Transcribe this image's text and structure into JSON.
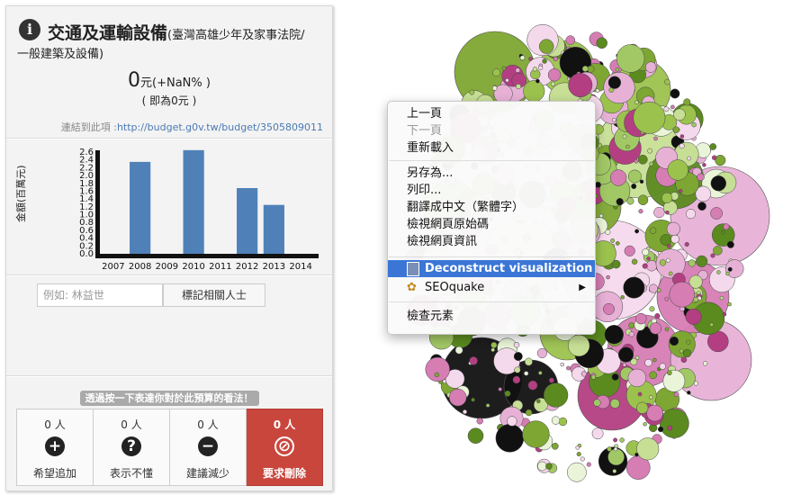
{
  "panel": {
    "title_main": "交通及運輸設備",
    "title_sub": "(臺灣高雄少年及家事法院/",
    "title_line2": "一般建築及設備)",
    "amount_value": "0",
    "amount_suffix": "元(+NaN% )",
    "amount_sub": "( 即為0元 )",
    "link_label": "連結到此項 :",
    "link_url": "http://budget.g0v.tw/budget/3505809011",
    "tag_placeholder": "例如: 林益世",
    "tag_button": "標記相關人士",
    "vote_prompt": "透過按一下表達你對於此預算的看法！",
    "votes": [
      {
        "count": "0 人",
        "icon": "plus-icon",
        "label": "希望追加"
      },
      {
        "count": "0 人",
        "icon": "question-icon",
        "label": "表示不懂"
      },
      {
        "count": "0 人",
        "icon": "minus-icon",
        "label": "建議減少"
      },
      {
        "count": "0 人",
        "icon": "ban-icon",
        "label": "要求刪除"
      }
    ],
    "accent_color": "#c9463d"
  },
  "chart_data": {
    "type": "bar",
    "ylabel": "金額(百萬元)",
    "categories": [
      "2007",
      "2008",
      "2009",
      "2010",
      "2011",
      "2012",
      "2013",
      "2014"
    ],
    "values": [
      0,
      2.35,
      0,
      2.65,
      0,
      1.68,
      1.25,
      0
    ],
    "yticks": [
      "0.0",
      "0.2",
      "0.4",
      "0.6",
      "0.8",
      "1.0",
      "1.2",
      "1.4",
      "1.6",
      "1.8",
      "2.0",
      "2.2",
      "2.4",
      "2.6"
    ],
    "ylim": [
      0,
      2.6
    ],
    "bar_color": "#4f81b8"
  },
  "menu": {
    "items": [
      {
        "label": "上一頁",
        "disabled": false
      },
      {
        "label": "下一頁",
        "disabled": true
      },
      {
        "label": "重新載入",
        "disabled": false
      },
      {
        "label": "另存為...",
        "disabled": false
      },
      {
        "label": "列印...",
        "disabled": false
      },
      {
        "label": "翻譯成中文（繁體字）",
        "disabled": false
      },
      {
        "label": "檢視網頁原始碼",
        "disabled": false
      },
      {
        "label": "檢視網頁資訊",
        "disabled": false
      },
      {
        "label": "Deconstruct visualization",
        "highlighted": true
      },
      {
        "label": "SEOquake",
        "submenu": true
      },
      {
        "label": "檢查元素",
        "disabled": false
      }
    ],
    "highlight_color": "#3b76d6"
  }
}
